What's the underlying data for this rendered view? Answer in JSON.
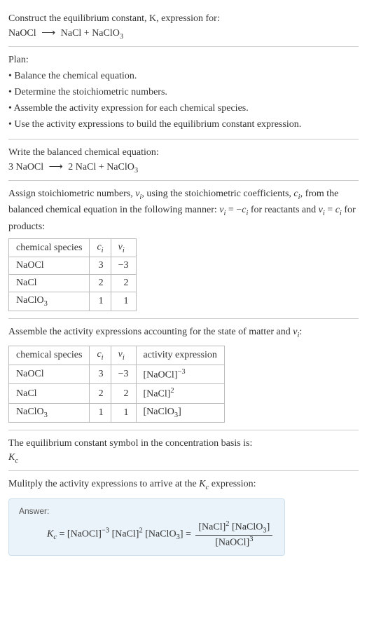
{
  "intro": {
    "line1": "Construct the equilibrium constant, K, expression for:",
    "equation_lhs": "NaOCl",
    "equation_arrow": "⟶",
    "equation_rhs": "NaCl + NaClO",
    "equation_rhs_sub": "3"
  },
  "plan": {
    "heading": "Plan:",
    "items": [
      "Balance the chemical equation.",
      "Determine the stoichiometric numbers.",
      "Assemble the activity expression for each chemical species.",
      "Use the activity expressions to build the equilibrium constant expression."
    ]
  },
  "balanced": {
    "heading": "Write the balanced chemical equation:",
    "lhs": "3 NaOCl",
    "arrow": "⟶",
    "rhs": "2 NaCl + NaClO",
    "rhs_sub": "3"
  },
  "stoich_text": {
    "pre": "Assign stoichiometric numbers, ",
    "nu": "ν",
    "sub_i": "i",
    "mid1": ", using the stoichiometric coefficients, ",
    "c": "c",
    "mid2": ", from the balanced chemical equation in the following manner: ",
    "rel1a": "ν",
    "rel1b": " = −",
    "rel1c": "c",
    "mid3": " for reactants and ",
    "rel2a": "ν",
    "rel2b": " = ",
    "rel2c": "c",
    "mid4": " for products:"
  },
  "table1": {
    "headers": {
      "species": "chemical species",
      "c": "c",
      "nu": "ν",
      "sub": "i"
    },
    "rows": [
      {
        "species": "NaOCl",
        "sub": "",
        "c": "3",
        "nu": "−3"
      },
      {
        "species": "NaCl",
        "sub": "",
        "c": "2",
        "nu": "2"
      },
      {
        "species": "NaClO",
        "sub": "3",
        "c": "1",
        "nu": "1"
      }
    ]
  },
  "activity_text": {
    "pre": "Assemble the activity expressions accounting for the state of matter and ",
    "nu": "ν",
    "sub": "i",
    "post": ":"
  },
  "table2": {
    "headers": {
      "species": "chemical species",
      "c": "c",
      "nu": "ν",
      "sub": "i",
      "activity": "activity expression"
    },
    "rows": [
      {
        "species": "NaOCl",
        "sub": "",
        "c": "3",
        "nu": "−3",
        "act_base": "[NaOCl]",
        "act_sup": "−3"
      },
      {
        "species": "NaCl",
        "sub": "",
        "c": "2",
        "nu": "2",
        "act_base": "[NaCl]",
        "act_sup": "2"
      },
      {
        "species": "NaClO",
        "sub": "3",
        "c": "1",
        "nu": "1",
        "act_base": "[NaClO",
        "act_sub": "3",
        "act_close": "]",
        "act_sup": ""
      }
    ]
  },
  "symbol_text": {
    "line": "The equilibrium constant symbol in the concentration basis is:",
    "K": "K",
    "sub": "c"
  },
  "multiply_text": {
    "pre": "Mulitply the activity expressions to arrive at the ",
    "K": "K",
    "sub": "c",
    "post": " expression:"
  },
  "answer": {
    "label": "Answer:",
    "K": "K",
    "Ksub": "c",
    "eq": " = ",
    "t1": "[NaOCl]",
    "t1sup": "−3",
    "t2": " [NaCl]",
    "t2sup": "2",
    "t3": " [NaClO",
    "t3sub": "3",
    "t3close": "] = ",
    "num1": "[NaCl]",
    "num1sup": "2",
    "num2": " [NaClO",
    "num2sub": "3",
    "num2close": "]",
    "den": "[NaOCl]",
    "densup": "3"
  }
}
